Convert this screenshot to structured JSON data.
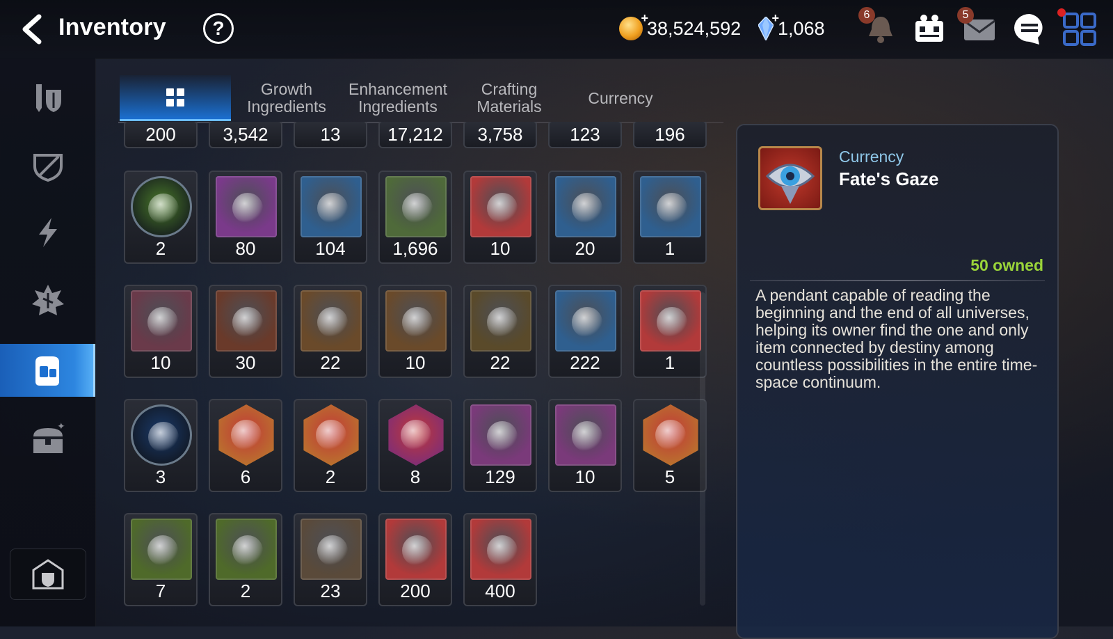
{
  "header": {
    "title": "Inventory",
    "help_label": "?",
    "gold": "38,524,592",
    "crystals": "1,068",
    "notifications_badge": "6",
    "mail_badge": "5",
    "add_symbol": "+"
  },
  "sidebar": {
    "items": [
      {
        "icon": "equipment-icon",
        "active": false
      },
      {
        "icon": "artifact-icon",
        "active": false
      },
      {
        "icon": "catalyst-icon",
        "active": false
      },
      {
        "icon": "rune-icon",
        "active": false
      },
      {
        "icon": "bag-icon",
        "active": true
      },
      {
        "icon": "chest-icon",
        "active": false
      }
    ],
    "bottom_icon": "guild-storage-icon"
  },
  "tabs": [
    {
      "label": "",
      "icon": "grid-icon",
      "active": true
    },
    {
      "label": "Growth\nIngredients",
      "active": false
    },
    {
      "label": "Enhancement\nIngredients",
      "active": false
    },
    {
      "label": "Crafting\nMaterials",
      "active": false
    },
    {
      "label": "Currency",
      "active": false
    }
  ],
  "grid": {
    "partial_row": [
      "200",
      "3,542",
      "13",
      "17,212",
      "3,758",
      "123",
      "196"
    ],
    "rows": [
      [
        {
          "count": "2",
          "icon": "hero-face-icon",
          "color": "#4a7a2a",
          "shape": "circle"
        },
        {
          "count": "80",
          "icon": "purple-flower-icon",
          "color": "#7a3a8a",
          "shape": "square"
        },
        {
          "count": "104",
          "icon": "gold-flower-icon",
          "color": "#2f5f8f",
          "shape": "square"
        },
        {
          "count": "1,696",
          "icon": "silver-flower-icon",
          "color": "#4f6a3a",
          "shape": "square"
        },
        {
          "count": "10",
          "icon": "purple-crescent-gem-icon",
          "color": "#b23a3a",
          "shape": "square"
        },
        {
          "count": "20",
          "icon": "purple-triangle-gem-icon",
          "color": "#2f5f8f",
          "shape": "square"
        },
        {
          "count": "1",
          "icon": "red-triangle-gem-icon",
          "color": "#2f5f8f",
          "shape": "square"
        }
      ],
      [
        {
          "count": "10",
          "icon": "pink-rune-stone-icon",
          "color": "#6a3a4a",
          "shape": "square"
        },
        {
          "count": "30",
          "icon": "red-rune-stone-icon",
          "color": "#6a3a2a",
          "shape": "square"
        },
        {
          "count": "22",
          "icon": "blue-rune-stone-icon",
          "color": "#6a4a2a",
          "shape": "square"
        },
        {
          "count": "10",
          "icon": "gold-rune-stone-icon",
          "color": "#6a4a2a",
          "shape": "square"
        },
        {
          "count": "22",
          "icon": "green-rune-stone-icon",
          "color": "#5a4a2a",
          "shape": "square"
        },
        {
          "count": "222",
          "icon": "root-herb-icon",
          "color": "#2f5f8f",
          "shape": "square"
        },
        {
          "count": "1",
          "icon": "green-orb-icon",
          "color": "#b23a3a",
          "shape": "square"
        }
      ],
      [
        {
          "count": "3",
          "icon": "blue-seal-icon",
          "color": "#1a3a6a",
          "shape": "circle"
        },
        {
          "count": "6",
          "icon": "red-hex-gem-icon",
          "color": "#b8862a",
          "shape": "hex"
        },
        {
          "count": "2",
          "icon": "pink-potion-icon",
          "color": "#b8862a",
          "shape": "hex"
        },
        {
          "count": "8",
          "icon": "teal-cross-gem-icon",
          "color": "#6a2a8a",
          "shape": "hex"
        },
        {
          "count": "129",
          "icon": "hammer-charm-icon",
          "color": "#7a3a7a",
          "shape": "square"
        },
        {
          "count": "10",
          "icon": "exclamation-charm-icon",
          "color": "#7a3a7a",
          "shape": "square"
        },
        {
          "count": "5",
          "icon": "white-cross-gem-icon",
          "color": "#b8862a",
          "shape": "hex"
        }
      ],
      [
        {
          "count": "7",
          "icon": "orange-hammer-charm-icon",
          "color": "#4f6a2a",
          "shape": "square"
        },
        {
          "count": "2",
          "icon": "orange-exclamation-charm-icon",
          "color": "#4f6a2a",
          "shape": "square"
        },
        {
          "count": "23",
          "icon": "blueprint-charm-icon",
          "color": "#5a4a3a",
          "shape": "square"
        },
        {
          "count": "200",
          "icon": "dark-ember-icon",
          "color": "#b23a3a",
          "shape": "square"
        },
        {
          "count": "400",
          "icon": "blue-feather-icon",
          "color": "#b23a3a",
          "shape": "square"
        }
      ]
    ]
  },
  "detail": {
    "category": "Currency",
    "name": "Fate's Gaze",
    "owned": "50 owned",
    "description": "A pendant capable of reading the beginning and the end of all universes, helping its owner find the one and only item connected by destiny among countless possibilities in the entire time-space continuum.",
    "icon": "eye-pendant-icon"
  },
  "colors": {
    "accent_blue": "#1b6fd0",
    "owned_green": "#9ad43a",
    "category_blue": "#8fc7e8"
  }
}
